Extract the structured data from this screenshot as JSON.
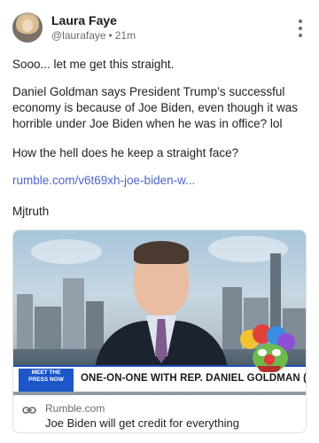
{
  "post": {
    "author_name": "Laura Faye",
    "handle": "@laurafaye",
    "separator": "•",
    "time_ago": "21m",
    "text_lines": [
      "Sooo... let me get this straight.",
      "Daniel Goldman says President Trump’s successful economy is because of Joe Biden, even though it was horrible under Joe Biden when he was in office? lol",
      "How the hell does he keep a straight face?",
      "rumble.com/v6t69xh-joe-biden-w...",
      "Mjtruth"
    ]
  },
  "card": {
    "chyron_logo": "MEET THE PRESS NOW",
    "chyron_text": "ONE-ON-ONE WITH REP. DANIEL GOLDMAN (D",
    "domain": "Rumble.com",
    "title": "Joe Biden will get credit for everything"
  },
  "icons": {
    "more": "more-vertical-icon",
    "link": "link-icon"
  },
  "colors": {
    "link": "#4f63c8",
    "chyron_blue": "#1c56c9"
  }
}
